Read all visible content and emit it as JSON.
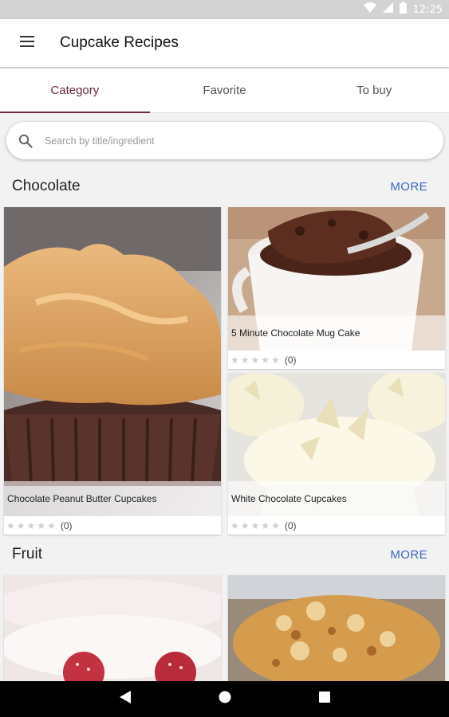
{
  "status_bar": {
    "time": "12:25"
  },
  "app_bar": {
    "title": "Cupcake Recipes"
  },
  "tabs": [
    {
      "label": "Category",
      "active": true
    },
    {
      "label": "Favorite",
      "active": false
    },
    {
      "label": "To buy",
      "active": false
    }
  ],
  "search": {
    "placeholder": "Search by title/ingredient",
    "value": ""
  },
  "sections": [
    {
      "title": "Chocolate",
      "more_label": "MORE",
      "recipes": [
        {
          "title": "Chocolate Peanut Butter Cupcakes",
          "rating": 0,
          "rating_count": "(0)"
        },
        {
          "title": "5 Minute Chocolate Mug Cake",
          "rating": 0,
          "rating_count": "(0)"
        },
        {
          "title": "White Chocolate Cupcakes",
          "rating": 0,
          "rating_count": "(0)"
        }
      ]
    },
    {
      "title": "Fruit",
      "more_label": "MORE",
      "recipes": [
        {
          "title": "",
          "rating": 0,
          "rating_count": ""
        },
        {
          "title": "",
          "rating": 0,
          "rating_count": ""
        }
      ]
    }
  ],
  "colors": {
    "accent": "#6b2a3f",
    "more_link": "#3a67c9",
    "star_empty": "#cfcfcf",
    "status_bar": "#d3d3d3"
  },
  "icons": {
    "menu": "hamburger-icon",
    "search": "search-icon",
    "nav_back": "back-triangle-icon",
    "nav_home": "home-circle-icon",
    "nav_recents": "recents-square-icon"
  }
}
